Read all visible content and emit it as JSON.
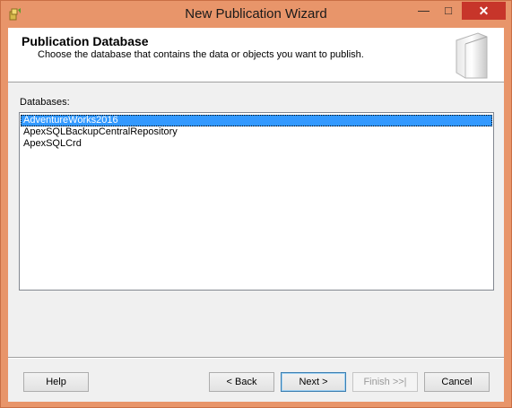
{
  "window": {
    "title": "New Publication Wizard",
    "close_glyph": "✕",
    "min_glyph": "—",
    "max_glyph": "□"
  },
  "header": {
    "title": "Publication Database",
    "description": "Choose the database that contains the data or objects you want to publish."
  },
  "databases": {
    "label": "Databases:",
    "items": [
      "AdventureWorks2016",
      "ApexSQLBackupCentralRepository",
      "ApexSQLCrd"
    ],
    "selected": "AdventureWorks2016"
  },
  "buttons": {
    "help": "Help",
    "back": "< Back",
    "next": "Next >",
    "finish": "Finish >>|",
    "cancel": "Cancel"
  },
  "colors": {
    "titlebar": "#e8956a",
    "selection": "#3399ff",
    "close": "#c7352a"
  },
  "icons": [
    "wizard-app-icon",
    "wizard-header-graphic"
  ]
}
